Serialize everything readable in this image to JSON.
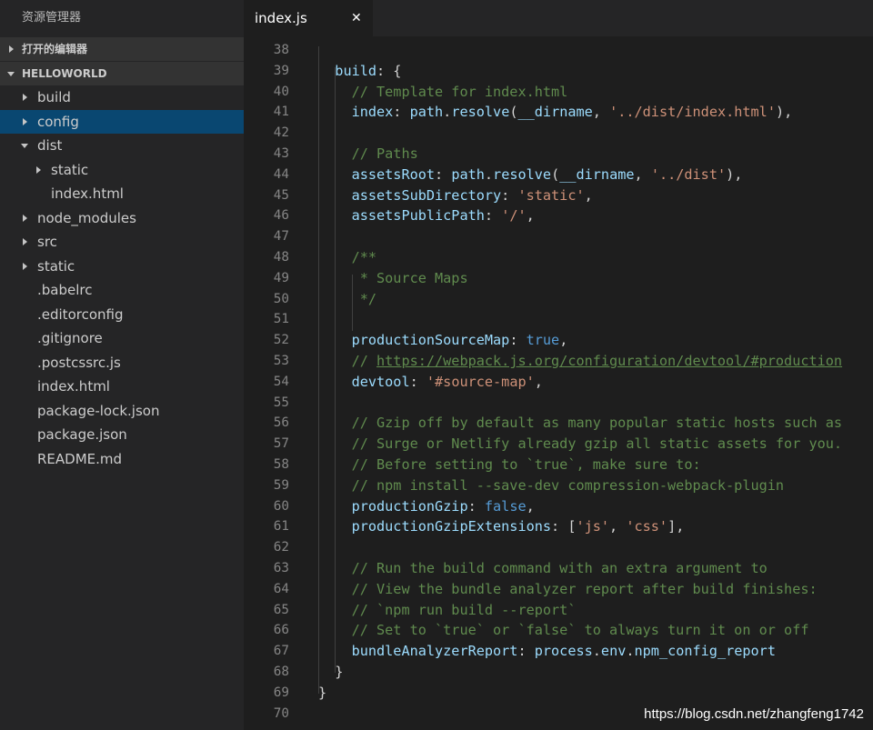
{
  "sidebar": {
    "title": "资源管理器",
    "open_editors": "打开的编辑器",
    "project": "HELLOWORLD",
    "tree": [
      {
        "label": "build",
        "indent": 0,
        "twisty": "right",
        "selected": false
      },
      {
        "label": "config",
        "indent": 0,
        "twisty": "right",
        "selected": true
      },
      {
        "label": "dist",
        "indent": 0,
        "twisty": "down",
        "selected": false
      },
      {
        "label": "static",
        "indent": 1,
        "twisty": "right",
        "selected": false
      },
      {
        "label": "index.html",
        "indent": 1,
        "twisty": "none",
        "selected": false
      },
      {
        "label": "node_modules",
        "indent": 0,
        "twisty": "right",
        "selected": false
      },
      {
        "label": "src",
        "indent": 0,
        "twisty": "right",
        "selected": false
      },
      {
        "label": "static",
        "indent": 0,
        "twisty": "right",
        "selected": false
      },
      {
        "label": ".babelrc",
        "indent": 0,
        "twisty": "none",
        "selected": false
      },
      {
        "label": ".editorconfig",
        "indent": 0,
        "twisty": "none",
        "selected": false
      },
      {
        "label": ".gitignore",
        "indent": 0,
        "twisty": "none",
        "selected": false
      },
      {
        "label": ".postcssrc.js",
        "indent": 0,
        "twisty": "none",
        "selected": false
      },
      {
        "label": "index.html",
        "indent": 0,
        "twisty": "none",
        "selected": false
      },
      {
        "label": "package-lock.json",
        "indent": 0,
        "twisty": "none",
        "selected": false
      },
      {
        "label": "package.json",
        "indent": 0,
        "twisty": "none",
        "selected": false
      },
      {
        "label": "README.md",
        "indent": 0,
        "twisty": "none",
        "selected": false
      }
    ]
  },
  "tab": {
    "label": "index.js",
    "close": "✕"
  },
  "editor": {
    "lines": [
      {
        "n": "38",
        "t": []
      },
      {
        "n": "39",
        "t": [
          [
            "",
            "  "
          ],
          [
            "p",
            "build"
          ],
          [
            "u",
            ": {"
          ]
        ]
      },
      {
        "n": "40",
        "t": [
          [
            "",
            "    "
          ],
          [
            "c",
            "// Template for index.html"
          ]
        ]
      },
      {
        "n": "41",
        "t": [
          [
            "",
            "    "
          ],
          [
            "p",
            "index"
          ],
          [
            "u",
            ": "
          ],
          [
            "p",
            "path"
          ],
          [
            "u",
            "."
          ],
          [
            "p",
            "resolve"
          ],
          [
            "u",
            "("
          ],
          [
            "p",
            "__dirname"
          ],
          [
            "u",
            ", "
          ],
          [
            "s",
            "'../dist/index.html'"
          ],
          [
            "u",
            "),"
          ]
        ]
      },
      {
        "n": "42",
        "t": []
      },
      {
        "n": "43",
        "t": [
          [
            "",
            "    "
          ],
          [
            "c",
            "// Paths"
          ]
        ]
      },
      {
        "n": "44",
        "t": [
          [
            "",
            "    "
          ],
          [
            "p",
            "assetsRoot"
          ],
          [
            "u",
            ": "
          ],
          [
            "p",
            "path"
          ],
          [
            "u",
            "."
          ],
          [
            "p",
            "resolve"
          ],
          [
            "u",
            "("
          ],
          [
            "p",
            "__dirname"
          ],
          [
            "u",
            ", "
          ],
          [
            "s",
            "'../dist'"
          ],
          [
            "u",
            "),"
          ]
        ]
      },
      {
        "n": "45",
        "t": [
          [
            "",
            "    "
          ],
          [
            "p",
            "assetsSubDirectory"
          ],
          [
            "u",
            ": "
          ],
          [
            "s",
            "'static'"
          ],
          [
            "u",
            ","
          ]
        ]
      },
      {
        "n": "46",
        "t": [
          [
            "",
            "    "
          ],
          [
            "p",
            "assetsPublicPath"
          ],
          [
            "u",
            ": "
          ],
          [
            "s",
            "'/'"
          ],
          [
            "u",
            ","
          ]
        ]
      },
      {
        "n": "47",
        "t": []
      },
      {
        "n": "48",
        "t": [
          [
            "",
            "    "
          ],
          [
            "c",
            "/**"
          ]
        ]
      },
      {
        "n": "49",
        "t": [
          [
            "",
            "     "
          ],
          [
            "c",
            "* Source Maps"
          ]
        ]
      },
      {
        "n": "50",
        "t": [
          [
            "",
            "     "
          ],
          [
            "c",
            "*/"
          ]
        ]
      },
      {
        "n": "51",
        "t": []
      },
      {
        "n": "52",
        "t": [
          [
            "",
            "    "
          ],
          [
            "p",
            "productionSourceMap"
          ],
          [
            "u",
            ": "
          ],
          [
            "k",
            "true"
          ],
          [
            "u",
            ","
          ]
        ]
      },
      {
        "n": "53",
        "t": [
          [
            "",
            "    "
          ],
          [
            "c",
            "// "
          ],
          [
            "l",
            "https://webpack.js.org/configuration/devtool/#production"
          ]
        ]
      },
      {
        "n": "54",
        "t": [
          [
            "",
            "    "
          ],
          [
            "p",
            "devtool"
          ],
          [
            "u",
            ": "
          ],
          [
            "s",
            "'#source-map'"
          ],
          [
            "u",
            ","
          ]
        ]
      },
      {
        "n": "55",
        "t": []
      },
      {
        "n": "56",
        "t": [
          [
            "",
            "    "
          ],
          [
            "c",
            "// Gzip off by default as many popular static hosts such as"
          ]
        ]
      },
      {
        "n": "57",
        "t": [
          [
            "",
            "    "
          ],
          [
            "c",
            "// Surge or Netlify already gzip all static assets for you."
          ]
        ]
      },
      {
        "n": "58",
        "t": [
          [
            "",
            "    "
          ],
          [
            "c",
            "// Before setting to `true`, make sure to:"
          ]
        ]
      },
      {
        "n": "59",
        "t": [
          [
            "",
            "    "
          ],
          [
            "c",
            "// npm install --save-dev compression-webpack-plugin"
          ]
        ]
      },
      {
        "n": "60",
        "t": [
          [
            "",
            "    "
          ],
          [
            "p",
            "productionGzip"
          ],
          [
            "u",
            ": "
          ],
          [
            "k",
            "false"
          ],
          [
            "u",
            ","
          ]
        ]
      },
      {
        "n": "61",
        "t": [
          [
            "",
            "    "
          ],
          [
            "p",
            "productionGzipExtensions"
          ],
          [
            "u",
            ": ["
          ],
          [
            "s",
            "'js'"
          ],
          [
            "u",
            ", "
          ],
          [
            "s",
            "'css'"
          ],
          [
            "u",
            "],"
          ]
        ]
      },
      {
        "n": "62",
        "t": []
      },
      {
        "n": "63",
        "t": [
          [
            "",
            "    "
          ],
          [
            "c",
            "// Run the build command with an extra argument to"
          ]
        ]
      },
      {
        "n": "64",
        "t": [
          [
            "",
            "    "
          ],
          [
            "c",
            "// View the bundle analyzer report after build finishes:"
          ]
        ]
      },
      {
        "n": "65",
        "t": [
          [
            "",
            "    "
          ],
          [
            "c",
            "// `npm run build --report`"
          ]
        ]
      },
      {
        "n": "66",
        "t": [
          [
            "",
            "    "
          ],
          [
            "c",
            "// Set to `true` or `false` to always turn it on or off"
          ]
        ]
      },
      {
        "n": "67",
        "t": [
          [
            "",
            "    "
          ],
          [
            "p",
            "bundleAnalyzerReport"
          ],
          [
            "u",
            ": "
          ],
          [
            "p",
            "process"
          ],
          [
            "u",
            "."
          ],
          [
            "p",
            "env"
          ],
          [
            "u",
            "."
          ],
          [
            "p",
            "npm_config_report"
          ]
        ]
      },
      {
        "n": "68",
        "t": [
          [
            "",
            "  "
          ],
          [
            "u",
            "}"
          ]
        ]
      },
      {
        "n": "69",
        "t": [
          [
            "u",
            "}"
          ]
        ]
      },
      {
        "n": "70",
        "t": []
      }
    ]
  },
  "annotation": {
    "arrow_color": "#e8302a"
  },
  "watermark": "https://blog.csdn.net/zhangfeng1742"
}
